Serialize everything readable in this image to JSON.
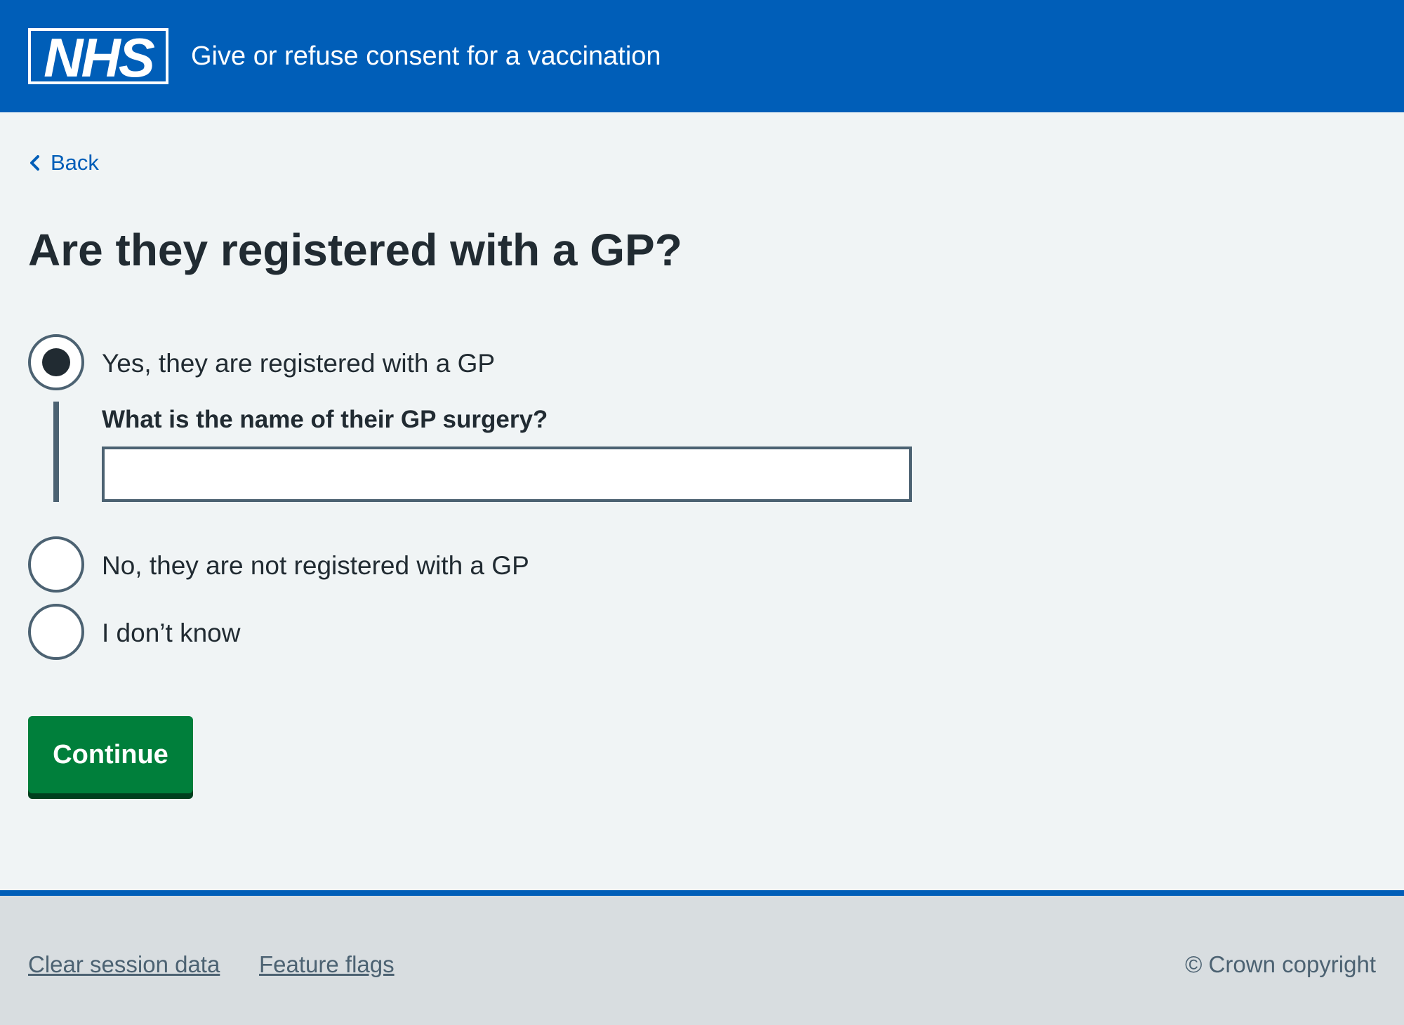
{
  "header": {
    "logo_text": "NHS",
    "service_name": "Give or refuse consent for a vaccination"
  },
  "nav": {
    "back_label": "Back",
    "back_icon": "chevron-left-icon"
  },
  "page": {
    "title": "Are they registered with a GP?"
  },
  "form": {
    "options": [
      {
        "label": "Yes, they are registered with a GP",
        "selected": true
      },
      {
        "label": "No, they are not registered with a GP",
        "selected": false
      },
      {
        "label": "I don’t know",
        "selected": false
      }
    ],
    "conditional": {
      "label": "What is the name of their GP surgery?",
      "value": "",
      "placeholder": ""
    },
    "submit_label": "Continue"
  },
  "footer": {
    "links": [
      "Clear session data",
      "Feature flags"
    ],
    "copyright": "© Crown copyright"
  },
  "colors": {
    "brand_blue": "#005eb8",
    "button_green": "#007f3b",
    "page_background": "#f0f4f5",
    "footer_background": "#d8dde0",
    "text": "#212b32",
    "secondary_text": "#4c6272"
  }
}
